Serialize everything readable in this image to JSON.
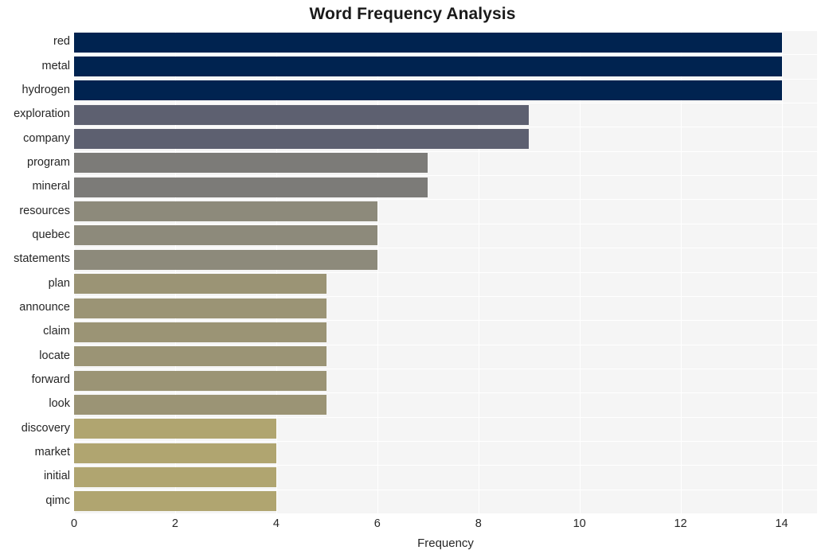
{
  "chart_data": {
    "type": "bar",
    "orientation": "horizontal",
    "title": "Word Frequency Analysis",
    "xlabel": "Frequency",
    "ylabel": "",
    "categories": [
      "red",
      "metal",
      "hydrogen",
      "exploration",
      "company",
      "program",
      "mineral",
      "resources",
      "quebec",
      "statements",
      "plan",
      "announce",
      "claim",
      "locate",
      "forward",
      "look",
      "discovery",
      "market",
      "initial",
      "qimc"
    ],
    "values": [
      14,
      14,
      14,
      9,
      9,
      7,
      7,
      6,
      6,
      6,
      5,
      5,
      5,
      5,
      5,
      5,
      4,
      4,
      4,
      4
    ],
    "xlim": [
      0,
      14.7
    ],
    "xticks": [
      0,
      2,
      4,
      6,
      8,
      10,
      12,
      14
    ],
    "xticklabels": [
      "0",
      "2",
      "4",
      "6",
      "8",
      "10",
      "12",
      "14"
    ],
    "grid": true,
    "legend": null,
    "bar_colors": [
      "#002350",
      "#002350",
      "#002350",
      "#5d6070",
      "#5d6070",
      "#7c7b78",
      "#7c7b78",
      "#8d8a7b",
      "#8d8a7b",
      "#8d8a7b",
      "#9b9475",
      "#9b9475",
      "#9b9475",
      "#9b9475",
      "#9b9475",
      "#9b9475",
      "#b0a570",
      "#b0a570",
      "#b0a570",
      "#b0a570"
    ],
    "plot_background": "#f5f5f5",
    "gridline_color": "#ffffff",
    "figure_background": "#ffffff"
  }
}
